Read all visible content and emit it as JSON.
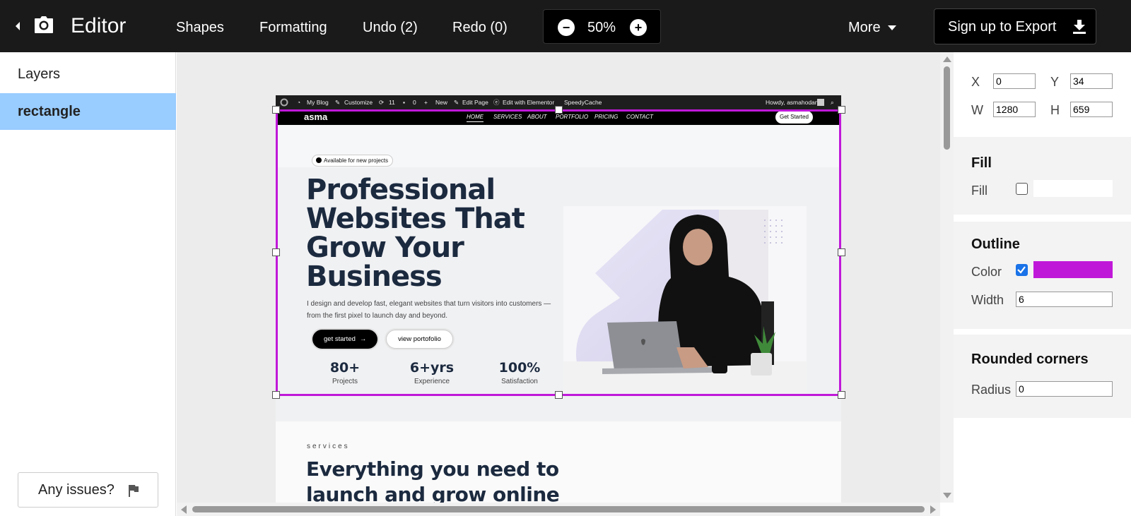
{
  "topbar": {
    "title": "Editor",
    "menu": [
      "Shapes",
      "Formatting",
      "Undo (2)",
      "Redo (0)"
    ],
    "zoom": "50%",
    "zoom_out": "−",
    "zoom_in": "+",
    "more": "More",
    "export": "Sign up to Export",
    "icons": [
      "back-arrow-icon",
      "camera-icon",
      "caret-down-icon",
      "download-icon"
    ]
  },
  "layers": {
    "title": "Layers",
    "items": [
      "rectangle"
    ],
    "issues": "Any issues?"
  },
  "props": {
    "x_label": "X",
    "x": "0",
    "y_label": "Y",
    "y": "34",
    "w_label": "W",
    "w": "1280",
    "h_label": "H",
    "h": "659",
    "fill_head": "Fill",
    "fill_label": "Fill",
    "fill_checked": false,
    "outline_head": "Outline",
    "color_label": "Color",
    "color_checked": true,
    "outline_color": "#c018d9",
    "width_label": "Width",
    "width": "6",
    "corners_head": "Rounded corners",
    "radius_label": "Radius",
    "radius": "0"
  },
  "preview": {
    "wpbar": {
      "myblog": "My Blog",
      "customize": "Customize",
      "updates": "11",
      "comments": "0",
      "new": "New",
      "editpage": "Edit Page",
      "elementor": "Edit with Elementor",
      "speedy": "SpeedyCache",
      "howdy": "Howdy, asmahodan"
    },
    "logo": "asma",
    "nav": [
      "HOME",
      "SERVICES",
      "ABOUT",
      "PORTFOLIO",
      "PRICING",
      "CONTACT"
    ],
    "cta": "Get Started",
    "badge": "Available for new projects",
    "headline": "Professional Websites That Grow Your Business",
    "description": "I design and develop fast, elegant websites that turn visitors into customers — from the first pixel to launch day and beyond.",
    "btn_primary": "get started",
    "btn_secondary": "view portofolio",
    "stats": [
      {
        "value": "80+",
        "label": "Projects"
      },
      {
        "value": "6+yrs",
        "label": "Experience"
      },
      {
        "value": "100%",
        "label": "Satisfaction"
      }
    ],
    "services_eyebrow": "services",
    "services_heading": "Everything you need to launch and grow online"
  }
}
